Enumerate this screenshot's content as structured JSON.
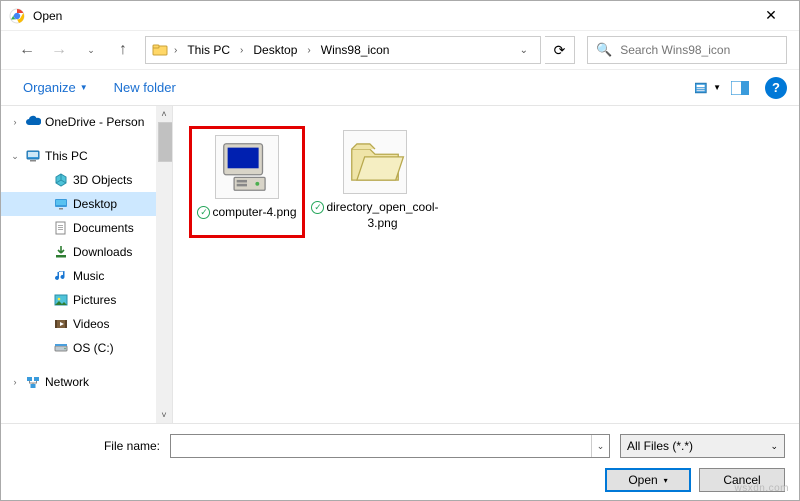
{
  "window": {
    "title": "Open"
  },
  "nav": {
    "breadcrumbs": [
      "This PC",
      "Desktop",
      "Wins98_icon"
    ],
    "search_placeholder": "Search Wins98_icon"
  },
  "toolbar": {
    "organize": "Organize",
    "new_folder": "New folder"
  },
  "sidebar": {
    "items": [
      {
        "label": "OneDrive - Person",
        "icon": "onedrive",
        "exp": "›"
      },
      {
        "label": "This PC",
        "icon": "pc",
        "exp": "⌄"
      },
      {
        "label": "3D Objects",
        "icon": "3d",
        "indent": 2
      },
      {
        "label": "Desktop",
        "icon": "desktop",
        "indent": 2,
        "selected": true
      },
      {
        "label": "Documents",
        "icon": "documents",
        "indent": 2
      },
      {
        "label": "Downloads",
        "icon": "downloads",
        "indent": 2
      },
      {
        "label": "Music",
        "icon": "music",
        "indent": 2
      },
      {
        "label": "Pictures",
        "icon": "pictures",
        "indent": 2
      },
      {
        "label": "Videos",
        "icon": "videos",
        "indent": 2
      },
      {
        "label": "OS (C:)",
        "icon": "drive",
        "indent": 2
      },
      {
        "label": "Network",
        "icon": "network",
        "exp": "›"
      }
    ]
  },
  "files": [
    {
      "name": "computer-4.png",
      "icon": "computer",
      "highlighted": true
    },
    {
      "name": "directory_open_cool-3.png",
      "icon": "folder",
      "highlighted": false
    }
  ],
  "bottom": {
    "filename_label": "File name:",
    "filename_value": "",
    "filter": "All Files (*.*)",
    "open": "Open",
    "cancel": "Cancel"
  },
  "watermark": "wsxdn.com"
}
